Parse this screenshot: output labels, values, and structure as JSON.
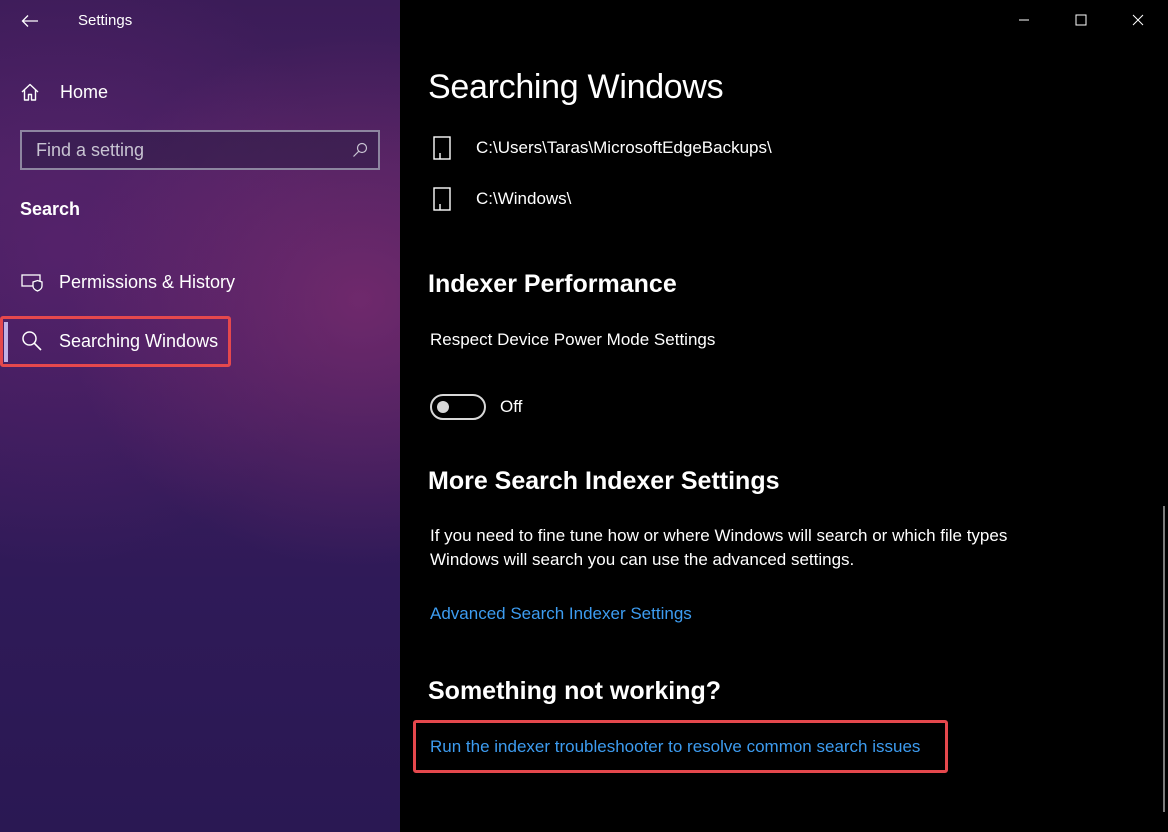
{
  "window": {
    "title": "Settings",
    "controls": {
      "minimize": "minimize",
      "maximize": "maximize",
      "close": "close"
    }
  },
  "sidebar": {
    "home_label": "Home",
    "search": {
      "placeholder": "Find a setting"
    },
    "section_label": "Search",
    "items": [
      {
        "label": "Permissions & History",
        "icon": "permissions-shield-icon"
      },
      {
        "label": "Searching Windows",
        "icon": "search-icon",
        "selected": true
      }
    ]
  },
  "main": {
    "title": "Searching Windows",
    "excluded_folders": [
      {
        "path": "C:\\Users\\Taras\\MicrosoftEdgeBackups\\"
      },
      {
        "path": "C:\\Windows\\"
      }
    ],
    "indexer_performance": {
      "heading": "Indexer Performance",
      "setting_label": "Respect Device Power Mode Settings",
      "toggle_state": "Off",
      "toggle_on": false
    },
    "more_settings": {
      "heading": "More Search Indexer Settings",
      "description": "If you need to fine tune how or where Windows will search or which file types Windows will search you can use the advanced settings.",
      "link": "Advanced Search Indexer Settings"
    },
    "troubleshoot": {
      "heading": "Something not working?",
      "link": "Run the indexer troubleshooter to resolve common search issues"
    }
  },
  "colors": {
    "link": "#3d9cf0",
    "highlight": "#e5484d",
    "sidebar_bg": "#3b1c58",
    "main_bg": "#000000"
  }
}
